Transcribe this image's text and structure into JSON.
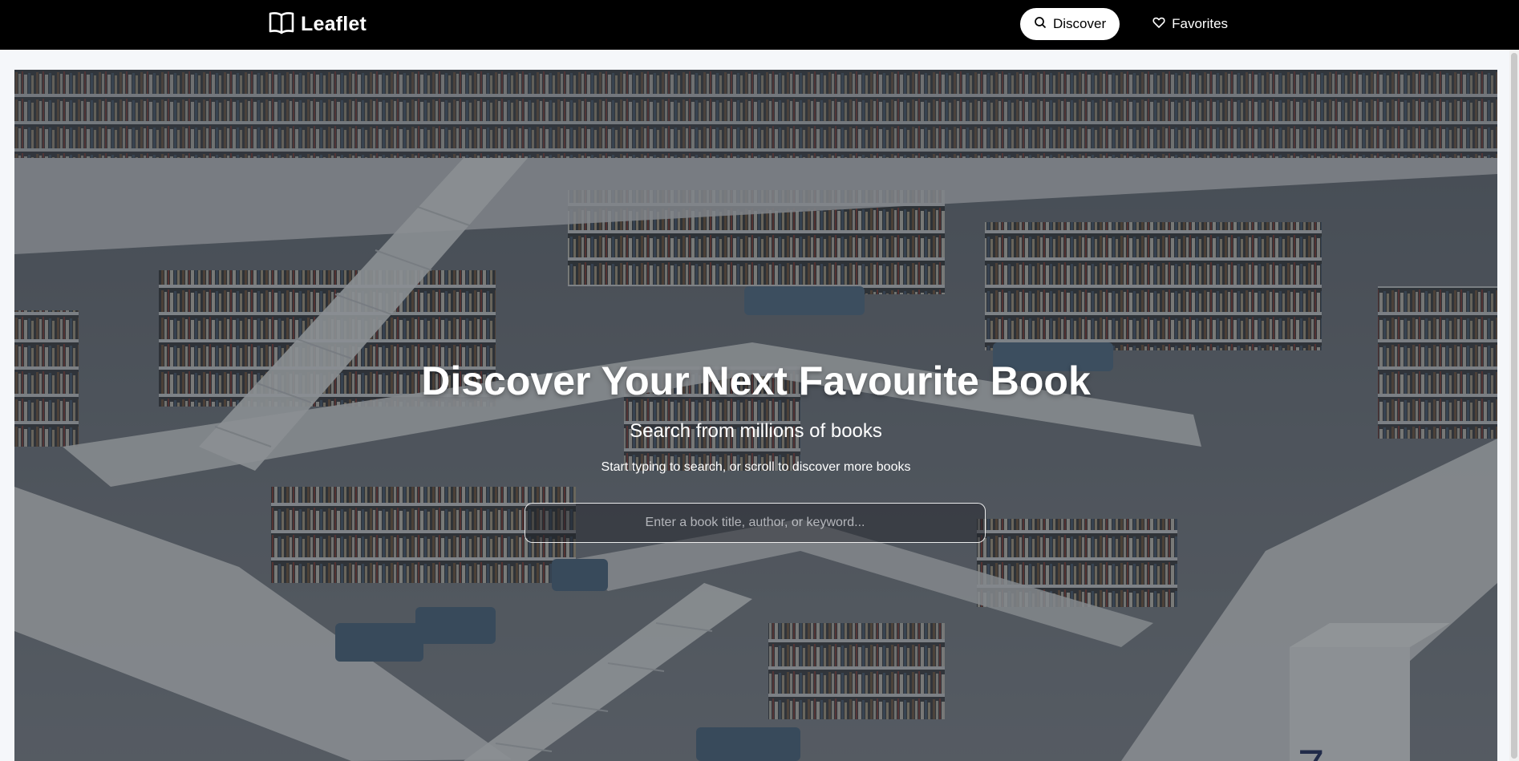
{
  "header": {
    "brand": "Leaflet",
    "brand_icon": "open-book-icon",
    "nav": [
      {
        "label": "Discover",
        "icon": "search-icon",
        "active": true
      },
      {
        "label": "Favorites",
        "icon": "heart-icon",
        "active": false
      }
    ]
  },
  "hero": {
    "title": "Discover Your Next Favourite Book",
    "subtitle": "Search from millions of books",
    "hint": "Start typing to search, or scroll to discover more books",
    "search_placeholder": "Enter a book title, author, or keyword...",
    "search_value": ""
  },
  "colors": {
    "header_bg": "#000000",
    "page_bg": "#f5f7fa",
    "active_nav_bg": "#ffffff"
  }
}
